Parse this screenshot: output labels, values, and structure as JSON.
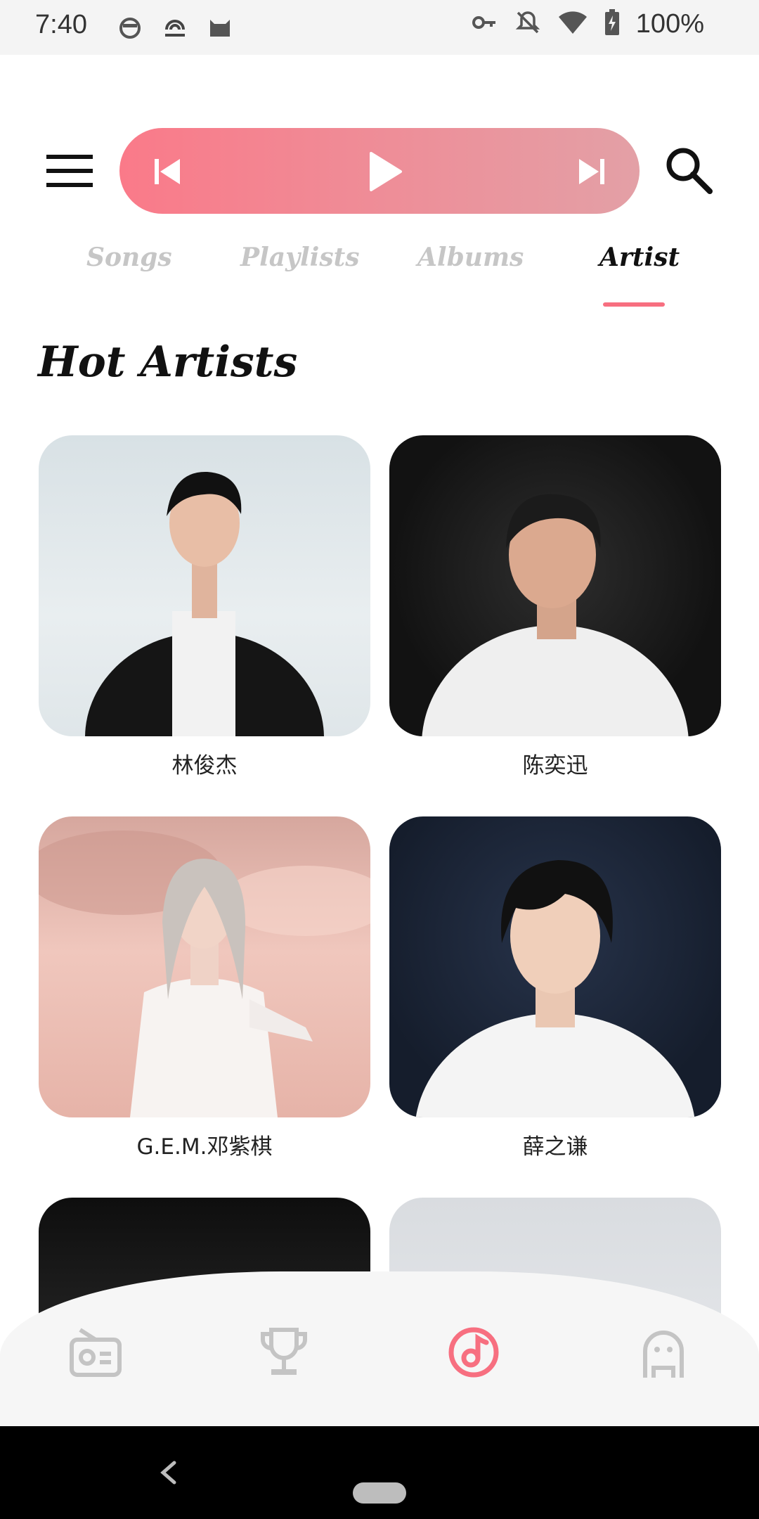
{
  "status_bar": {
    "time": "7:40",
    "battery_text": "100%",
    "left_icons": [
      "cat-face-icon",
      "broadcast-logo-icon",
      "cat-icon"
    ],
    "right_icons": [
      "vpn-key-icon",
      "notifications-off-icon",
      "wifi-icon",
      "battery-charging-icon"
    ]
  },
  "header": {
    "menu_icon": "menu-icon",
    "player": {
      "prev_icon": "skip-previous-icon",
      "play_icon": "play-icon",
      "next_icon": "skip-next-icon",
      "gradient_from": "#fa7a89",
      "gradient_to": "#e3a0a6"
    },
    "search_icon": "search-icon"
  },
  "tabs": [
    {
      "label": "Songs",
      "active": false
    },
    {
      "label": "Playlists",
      "active": false
    },
    {
      "label": "Albums",
      "active": false
    },
    {
      "label": "Artist",
      "active": true
    }
  ],
  "accent_color": "#f76f80",
  "section": {
    "title": "Hot Artists"
  },
  "artists": [
    {
      "name": "林俊杰"
    },
    {
      "name": "陈奕迅"
    },
    {
      "name": "G.E.M.邓紫棋"
    },
    {
      "name": "薛之谦"
    },
    {
      "name": ""
    },
    {
      "name": ""
    }
  ],
  "bottom_nav": [
    {
      "icon": "radio-icon",
      "active": false
    },
    {
      "icon": "trophy-icon",
      "active": false
    },
    {
      "icon": "music-note-icon",
      "active": true
    },
    {
      "icon": "profile-icon",
      "active": false
    }
  ]
}
